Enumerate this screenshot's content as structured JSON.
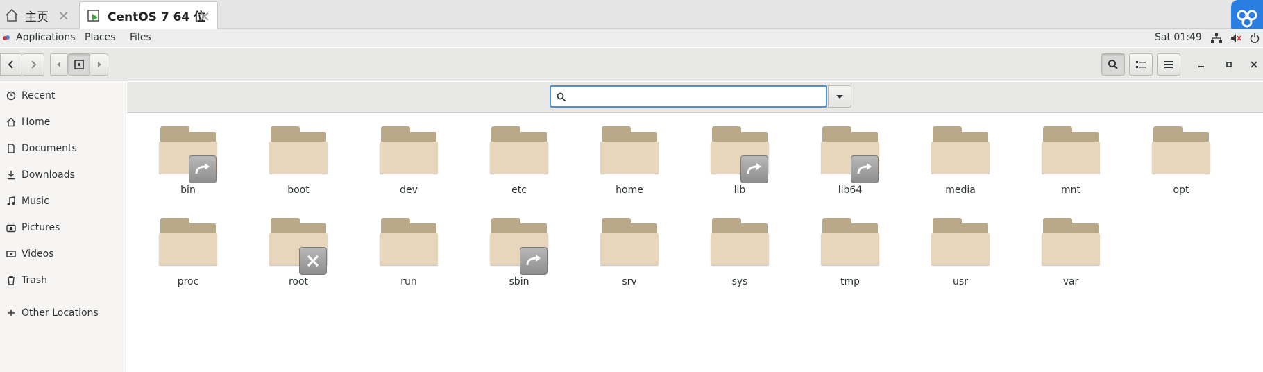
{
  "host_tabs": [
    {
      "label": "主页",
      "icon": "home-icon"
    },
    {
      "label": "CentOS 7 64 位",
      "icon": "vm-icon"
    }
  ],
  "topbar": {
    "applications": "Applications",
    "places": "Places",
    "files": "Files",
    "clock": "Sat 01:49"
  },
  "sidebar": {
    "items": [
      {
        "label": "Recent",
        "icon": "clock-icon"
      },
      {
        "label": "Home",
        "icon": "home-icon"
      },
      {
        "label": "Documents",
        "icon": "document-icon"
      },
      {
        "label": "Downloads",
        "icon": "download-icon"
      },
      {
        "label": "Music",
        "icon": "music-icon"
      },
      {
        "label": "Pictures",
        "icon": "camera-icon"
      },
      {
        "label": "Videos",
        "icon": "video-icon"
      },
      {
        "label": "Trash",
        "icon": "trash-icon"
      },
      {
        "label": "Other Locations",
        "icon": "plus-icon"
      }
    ]
  },
  "search": {
    "value": "",
    "placeholder": ""
  },
  "folders": [
    {
      "name": "bin",
      "emblem": "symlink"
    },
    {
      "name": "boot",
      "emblem": ""
    },
    {
      "name": "dev",
      "emblem": ""
    },
    {
      "name": "etc",
      "emblem": ""
    },
    {
      "name": "home",
      "emblem": ""
    },
    {
      "name": "lib",
      "emblem": "symlink"
    },
    {
      "name": "lib64",
      "emblem": "symlink"
    },
    {
      "name": "media",
      "emblem": ""
    },
    {
      "name": "mnt",
      "emblem": ""
    },
    {
      "name": "opt",
      "emblem": ""
    },
    {
      "name": "proc",
      "emblem": ""
    },
    {
      "name": "root",
      "emblem": "unreadable"
    },
    {
      "name": "run",
      "emblem": ""
    },
    {
      "name": "sbin",
      "emblem": "symlink"
    },
    {
      "name": "srv",
      "emblem": ""
    },
    {
      "name": "sys",
      "emblem": ""
    },
    {
      "name": "tmp",
      "emblem": ""
    },
    {
      "name": "usr",
      "emblem": ""
    },
    {
      "name": "var",
      "emblem": ""
    }
  ],
  "colors": {
    "accent": "#4a90d9",
    "folder_front": "#e7d6bb",
    "folder_back": "#b9a989"
  }
}
